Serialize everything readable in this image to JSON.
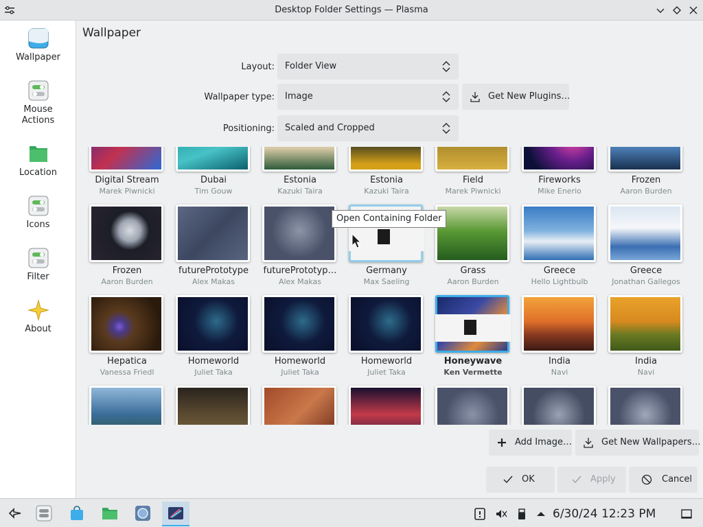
{
  "window": {
    "title": "Desktop Folder Settings — Plasma"
  },
  "sidebar": {
    "items": [
      {
        "label": "Wallpaper",
        "icon": "wallpaper-icon"
      },
      {
        "label": "Mouse\nActions",
        "icon": "toggle-settings-icon"
      },
      {
        "label": "Location",
        "icon": "folder-icon"
      },
      {
        "label": "Icons",
        "icon": "toggle-settings-icon"
      },
      {
        "label": "Filter",
        "icon": "toggle-settings-icon"
      },
      {
        "label": "About",
        "icon": "star-icon"
      }
    ]
  },
  "page": {
    "title": "Wallpaper"
  },
  "form": {
    "layout_label": "Layout:",
    "layout_value": "Folder View",
    "type_label": "Wallpaper type:",
    "type_value": "Image",
    "get_plugins": "Get New Plugins…",
    "positioning_label": "Positioning:",
    "positioning_value": "Scaled and Cropped"
  },
  "tooltip": "Open Containing Folder",
  "wallpapers": [
    {
      "name": "Digital Stream",
      "author": "Marek Piwnicki"
    },
    {
      "name": "Dubai",
      "author": "Tim Gouw"
    },
    {
      "name": "Estonia",
      "author": "Kazuki Taira"
    },
    {
      "name": "Estonia",
      "author": "Kazuki Taira"
    },
    {
      "name": "Field",
      "author": "Marek Piwnicki"
    },
    {
      "name": "Fireworks",
      "author": "Mike Enerio"
    },
    {
      "name": "Frozen",
      "author": "Aaron Burden"
    },
    {
      "name": "Frozen",
      "author": "Aaron Burden"
    },
    {
      "name": "futurePrototype",
      "author": "Alex Makas"
    },
    {
      "name": "futurePrototyp…",
      "author": "Alex Makas"
    },
    {
      "name": "Germany",
      "author": "Max Saeling"
    },
    {
      "name": "Grass",
      "author": "Aaron Burden"
    },
    {
      "name": "Greece",
      "author": "Hello Lightbulb"
    },
    {
      "name": "Greece",
      "author": "Jonathan Gallegos"
    },
    {
      "name": "Hepatica",
      "author": "Vanessa Friedl"
    },
    {
      "name": "Homeworld",
      "author": "Juliet Taka"
    },
    {
      "name": "Homeworld",
      "author": "Juliet Taka"
    },
    {
      "name": "Homeworld",
      "author": "Juliet Taka"
    },
    {
      "name": "Honeywave",
      "author": "Ken Vermette"
    },
    {
      "name": "India",
      "author": "Navi"
    },
    {
      "name": "India",
      "author": "Navi"
    }
  ],
  "buttons": {
    "add_image": "Add Image…",
    "get_wallpapers": "Get New Wallpapers…",
    "ok": "OK",
    "apply": "Apply",
    "cancel": "Cancel"
  },
  "taskbar": {
    "clock": "6/30/24 12:23 PM"
  }
}
